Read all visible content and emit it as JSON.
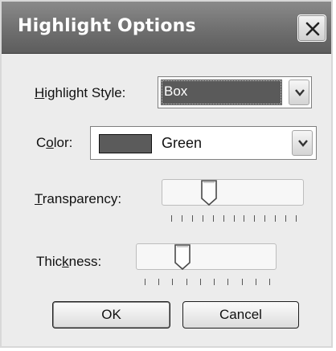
{
  "window": {
    "title": "Highlight Options"
  },
  "icons": {
    "close": "close-icon",
    "dropdown": "chevron-down-icon",
    "thumb": "slider-thumb-icon"
  },
  "highlight_style": {
    "label_mnemonic": "H",
    "label_rest": "ighlight Style:",
    "value": "Box"
  },
  "color": {
    "label_pre": "C",
    "label_mnemonic": "o",
    "label_rest": "lor:",
    "value": "Green",
    "swatch": "#5b5b5b"
  },
  "transparency": {
    "label_mnemonic": "T",
    "label_rest": "ransparency:",
    "level": 0.3,
    "tick_count": 13
  },
  "thickness": {
    "label_pre": "Thic",
    "label_mnemonic": "k",
    "label_rest": "ness:",
    "level": 0.3,
    "tick_count": 10
  },
  "buttons": {
    "ok": "OK",
    "cancel": "Cancel"
  },
  "colors": {
    "titlebar": "#6f6f6f",
    "selection": "#5a5a5a",
    "dialog_bg": "#ececec"
  }
}
